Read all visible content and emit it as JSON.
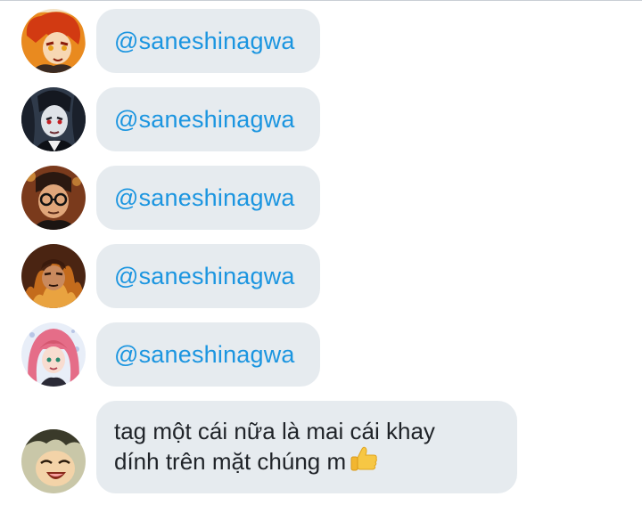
{
  "messages": [
    {
      "avatar": "red-hair-flame-avatar",
      "text": "@saneshinagwa"
    },
    {
      "avatar": "dark-hair-red-eyes-avatar",
      "text": "@saneshinagwa"
    },
    {
      "avatar": "glasses-character-avatar",
      "text": "@saneshinagwa"
    },
    {
      "avatar": "flame-character-avatar",
      "text": "@saneshinagwa"
    },
    {
      "avatar": "pink-hair-avatar",
      "text": "@saneshinagwa"
    }
  ],
  "last_message": {
    "avatar": "laughing-character-avatar",
    "line1": "tag một cái nữa là mai cái khay",
    "line2": "dính trên mặt chúng m",
    "emoji": "thumbs-up-icon"
  },
  "colors": {
    "bubble": "#e6ebef",
    "mention": "#1b95e0",
    "text": "#1f2328"
  }
}
